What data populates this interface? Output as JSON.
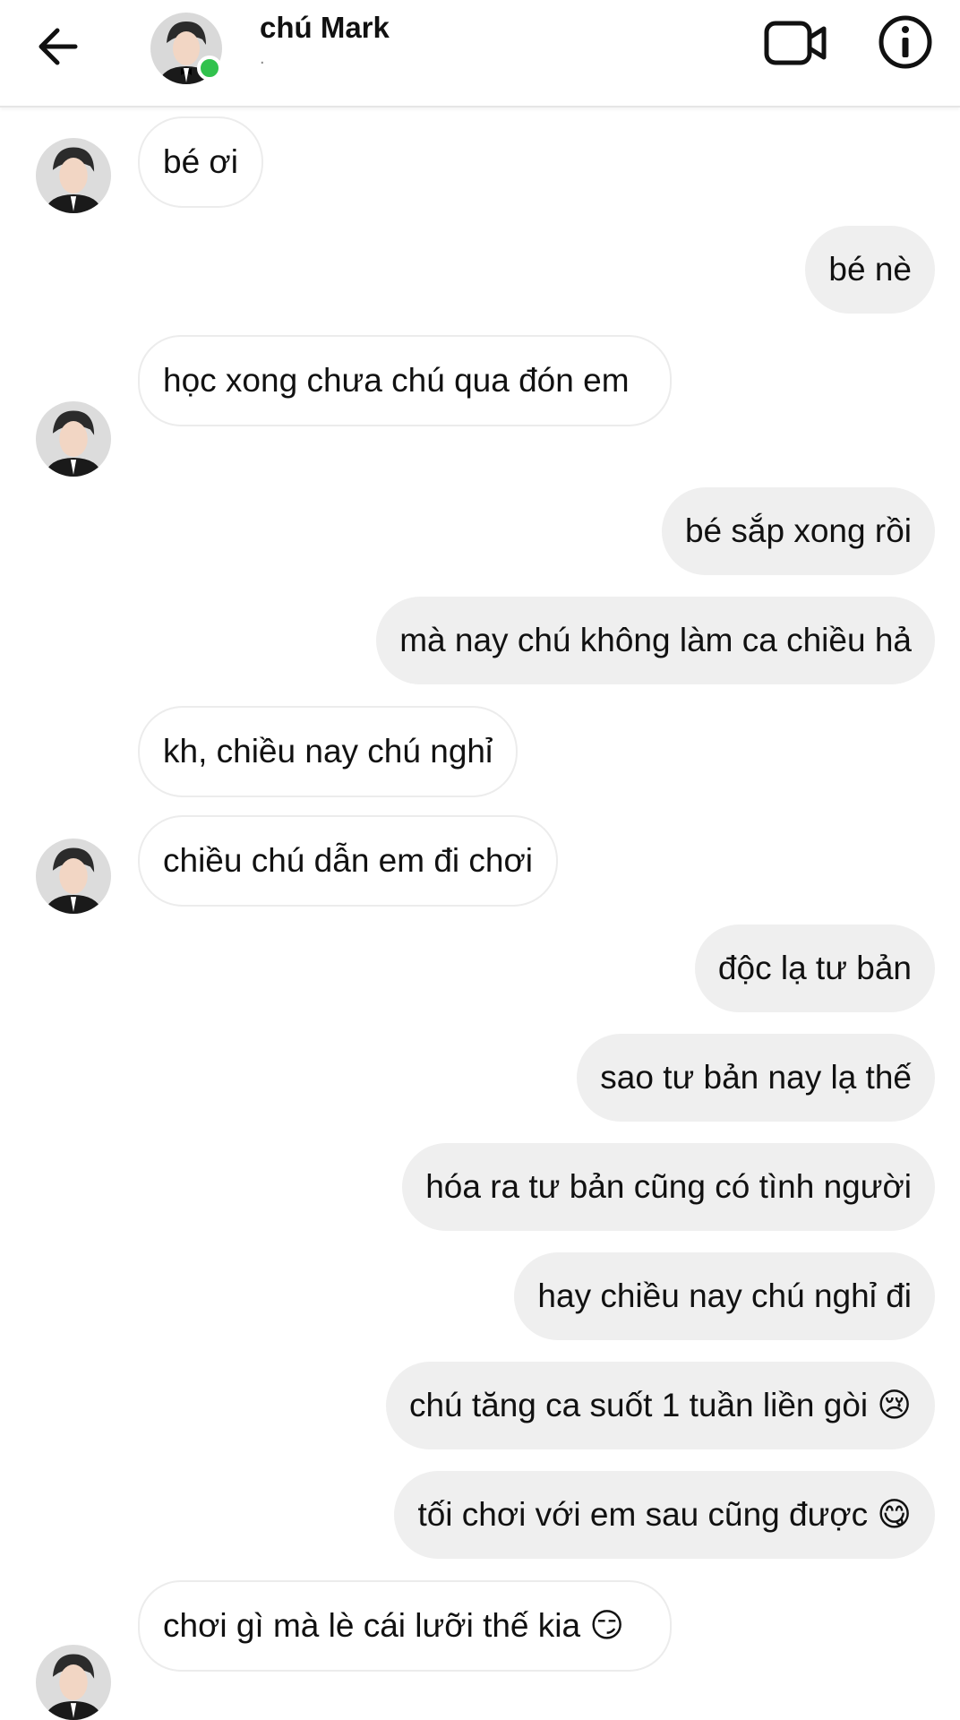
{
  "header": {
    "contact_name": "chú Mark",
    "status_text": ".",
    "back_icon": "arrow-left-icon",
    "video_icon": "video-camera-icon",
    "info_icon": "info-icon",
    "online_color": "#31c24d"
  },
  "messages": [
    {
      "side": "in",
      "text": "bé ơi"
    },
    {
      "side": "out",
      "text": "bé nè"
    },
    {
      "side": "in",
      "text": "học xong chưa chú qua đón em"
    },
    {
      "side": "out",
      "text": "bé sắp xong rồi"
    },
    {
      "side": "out",
      "text": "mà nay chú không làm ca chiều hả"
    },
    {
      "side": "in",
      "text": "kh, chiều nay chú nghỉ"
    },
    {
      "side": "in",
      "text": "chiều chú dẫn em đi chơi"
    },
    {
      "side": "out",
      "text": "độc lạ tư bản"
    },
    {
      "side": "out",
      "text": "sao tư bản nay lạ thế"
    },
    {
      "side": "out",
      "text": "hóa ra tư bản cũng có tình người"
    },
    {
      "side": "out",
      "text": "hay chiều nay chú nghỉ đi"
    },
    {
      "side": "out",
      "text": "chú tăng ca suốt 1 tuần liền gòi 😢"
    },
    {
      "side": "out",
      "text": "tối chơi với em sau cũng được 😋"
    },
    {
      "side": "in",
      "text": "chơi gì mà lè cái lưỡi thế kia 😏"
    }
  ],
  "colors": {
    "incoming_bubble": "#ffffff",
    "outgoing_bubble": "#efefef"
  }
}
